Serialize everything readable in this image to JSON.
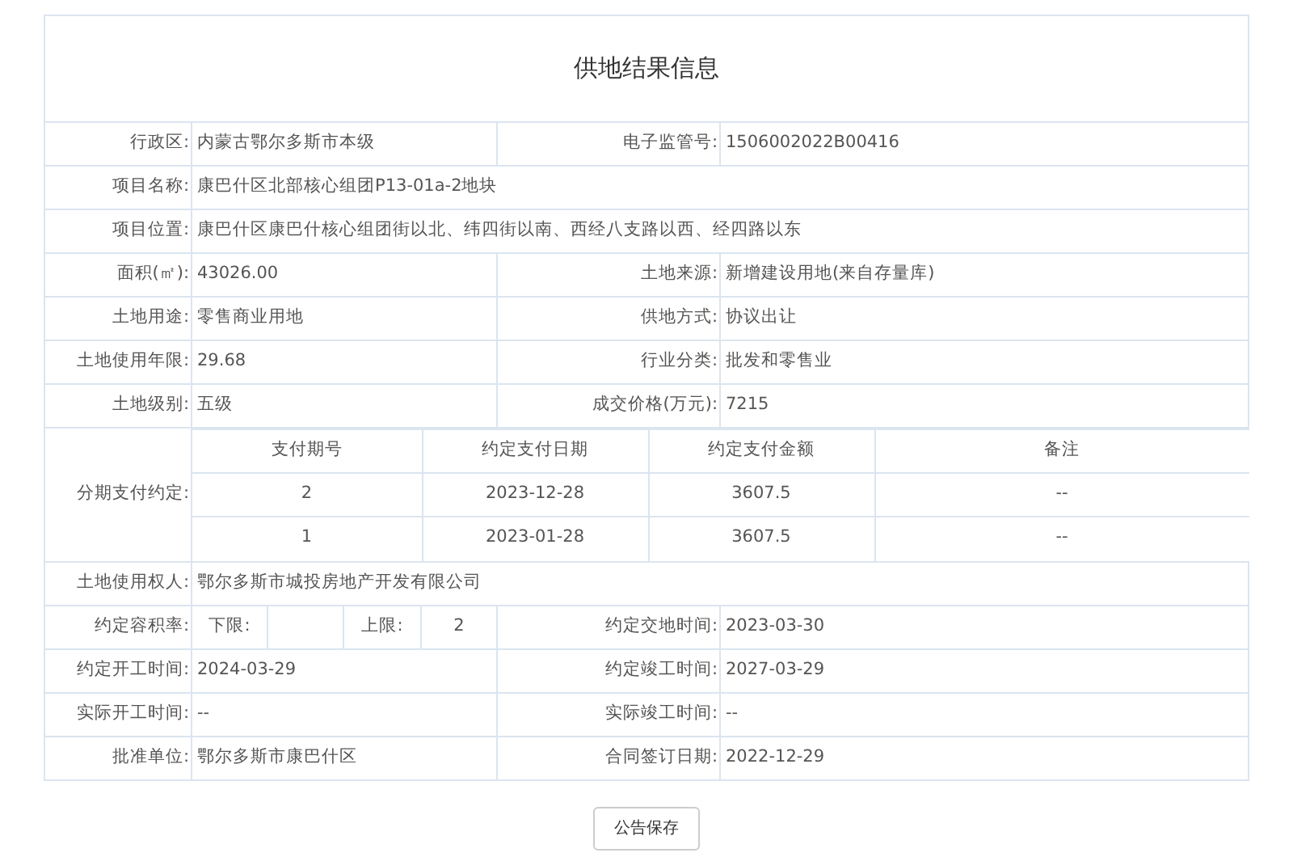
{
  "title": "供地结果信息",
  "rows": [
    {
      "kind": "pair",
      "cells": [
        {
          "label": "行政区:",
          "value": "内蒙古鄂尔多斯市本级"
        },
        {
          "label": "电子监管号:",
          "value": "1506002022B00416"
        }
      ]
    },
    {
      "kind": "wide",
      "cells": [
        {
          "label": "项目名称:",
          "value": "康巴什区北部核心组团P13-01a-2地块"
        }
      ]
    },
    {
      "kind": "wide",
      "cells": [
        {
          "label": "项目位置:",
          "value": "康巴什区康巴什核心组团街以北、纬四街以南、西经八支路以西、经四路以东"
        }
      ]
    },
    {
      "kind": "pair",
      "cells": [
        {
          "label": "面积(㎡):",
          "value": "43026.00"
        },
        {
          "label": "土地来源:",
          "value": "新增建设用地(来自存量库)"
        }
      ]
    },
    {
      "kind": "pair",
      "cells": [
        {
          "label": "土地用途:",
          "value": "零售商业用地"
        },
        {
          "label": "供地方式:",
          "value": "协议出让"
        }
      ]
    },
    {
      "kind": "pair",
      "cells": [
        {
          "label": "土地使用年限:",
          "value": "29.68"
        },
        {
          "label": "行业分类:",
          "value": "批发和零售业"
        }
      ]
    },
    {
      "kind": "pair",
      "cells": [
        {
          "label": "土地级别:",
          "value": "五级"
        },
        {
          "label": "成交价格(万元):",
          "value": "7215"
        }
      ]
    },
    {
      "kind": "installments",
      "label": "分期支付约定:",
      "columns": [
        "支付期号",
        "约定支付日期",
        "约定支付金额",
        "备注"
      ],
      "lines": [
        [
          "2",
          "2023-12-28",
          "3607.5",
          "--"
        ],
        [
          "1",
          "2023-01-28",
          "3607.5",
          "--"
        ]
      ]
    },
    {
      "kind": "wide",
      "cells": [
        {
          "label": "土地使用权人:",
          "value": "鄂尔多斯市城投房地产开发有限公司"
        }
      ]
    },
    {
      "kind": "ratio",
      "label": "约定容积率:",
      "lower_label": "下限:",
      "upper_label": "上限:",
      "upper_value": "2",
      "cells": [
        {
          "label": "约定交地时间:",
          "value": "2023-03-30"
        }
      ]
    },
    {
      "kind": "pair",
      "cells": [
        {
          "label": "约定开工时间:",
          "value": "2024-03-29"
        },
        {
          "label": "约定竣工时间:",
          "value": "2027-03-29"
        }
      ]
    },
    {
      "kind": "pair",
      "cells": [
        {
          "label": "实际开工时间:",
          "value": "--"
        },
        {
          "label": "实际竣工时间:",
          "value": "--"
        }
      ]
    },
    {
      "kind": "pair",
      "cells": [
        {
          "label": "批准单位:",
          "value": "鄂尔多斯市康巴什区"
        },
        {
          "label": "合同签订日期:",
          "value": "2022-12-29"
        }
      ]
    }
  ],
  "button": "公告保存"
}
